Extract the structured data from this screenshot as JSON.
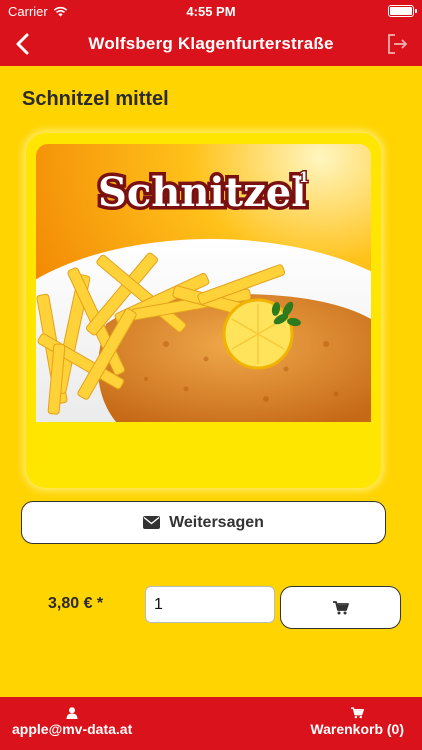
{
  "status_bar": {
    "carrier": "Carrier",
    "time": "4:55 PM"
  },
  "nav": {
    "title": "Wolfsberg Klagenfurterstraße",
    "back_icon": "chevron-left-icon",
    "logout_icon": "logout-icon"
  },
  "product": {
    "title": "Schnitzel mittel",
    "image_heading": "Schnitzel",
    "image_superscript": "1",
    "price": "3,80 € *",
    "quantity": "1"
  },
  "share": {
    "label": "Weitersagen",
    "icon": "envelope-icon"
  },
  "cart_add": {
    "icon": "cart-icon"
  },
  "bottom_bar": {
    "user_label": "apple@mv-data.at",
    "user_icon": "user-icon",
    "cart_label": "Warenkorb (0)",
    "cart_icon": "cart-icon"
  },
  "colors": {
    "primary_red": "#D9121B",
    "background_yellow": "#FFD400",
    "card_yellow": "#FFE600"
  }
}
